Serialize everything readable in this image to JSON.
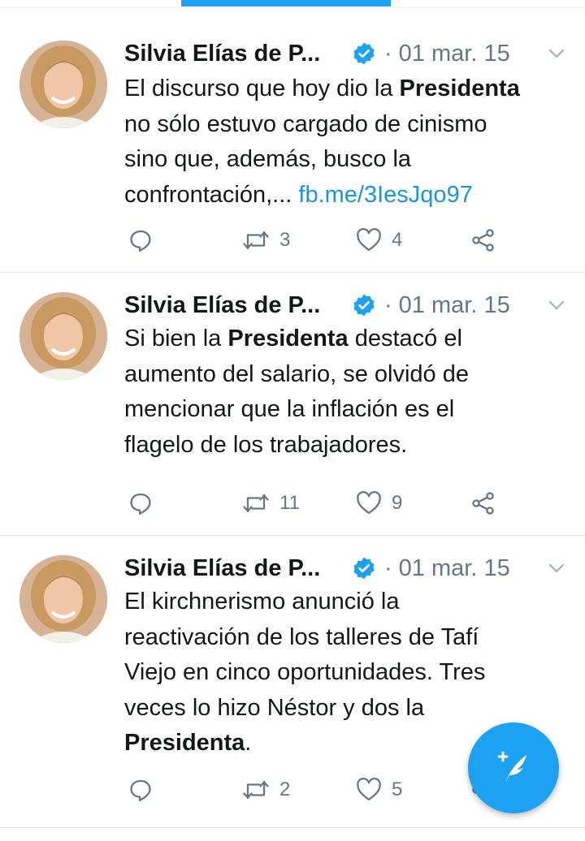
{
  "tweets": [
    {
      "author": "Silvia Elías de P...",
      "dot": "·",
      "date": "01 mar. 15",
      "text": {
        "l1a": "El discurso que hoy dio la ",
        "l1b": "Presidenta",
        "l2": "no sólo estuvo cargado de cinismo",
        "l3": "sino que, además, busco la",
        "l4a": "confrontación,... ",
        "l4link": "fb.me/3IesJqo97"
      },
      "retweets": "3",
      "likes": "4"
    },
    {
      "author": "Silvia Elías de P...",
      "dot": "·",
      "date": "01 mar. 15",
      "text": {
        "l1a": "Si bien la ",
        "l1b": "Presidenta",
        "l1c": " destacó el",
        "l2": "aumento del salario, se olvidó de",
        "l3": "mencionar que la inflación es el",
        "l4": "flagelo de los trabajadores."
      },
      "retweets": "11",
      "likes": "9"
    },
    {
      "author": "Silvia Elías de P...",
      "dot": "·",
      "date": "01 mar. 15",
      "text": {
        "l1": "El kirchnerismo anunció la",
        "l2": "reactivación de los talleres de Tafí",
        "l3": "Viejo en cinco oportunidades. Tres",
        "l4": "veces lo hizo Néstor y dos la",
        "l5a": "Presidenta",
        "l5b": "."
      },
      "retweets": "2",
      "likes": "5"
    }
  ],
  "icons": {
    "verified": "verified-badge-icon",
    "caret": "chevron-down-icon",
    "reply": "reply-icon",
    "retweet": "retweet-icon",
    "like": "heart-icon",
    "share": "share-icon",
    "compose": "compose-tweet-icon"
  },
  "colors": {
    "accent": "#1da1f2",
    "link": "#1b95e0",
    "text": "#14171a",
    "secondary": "#657786",
    "divider": "#e1e8ed"
  }
}
